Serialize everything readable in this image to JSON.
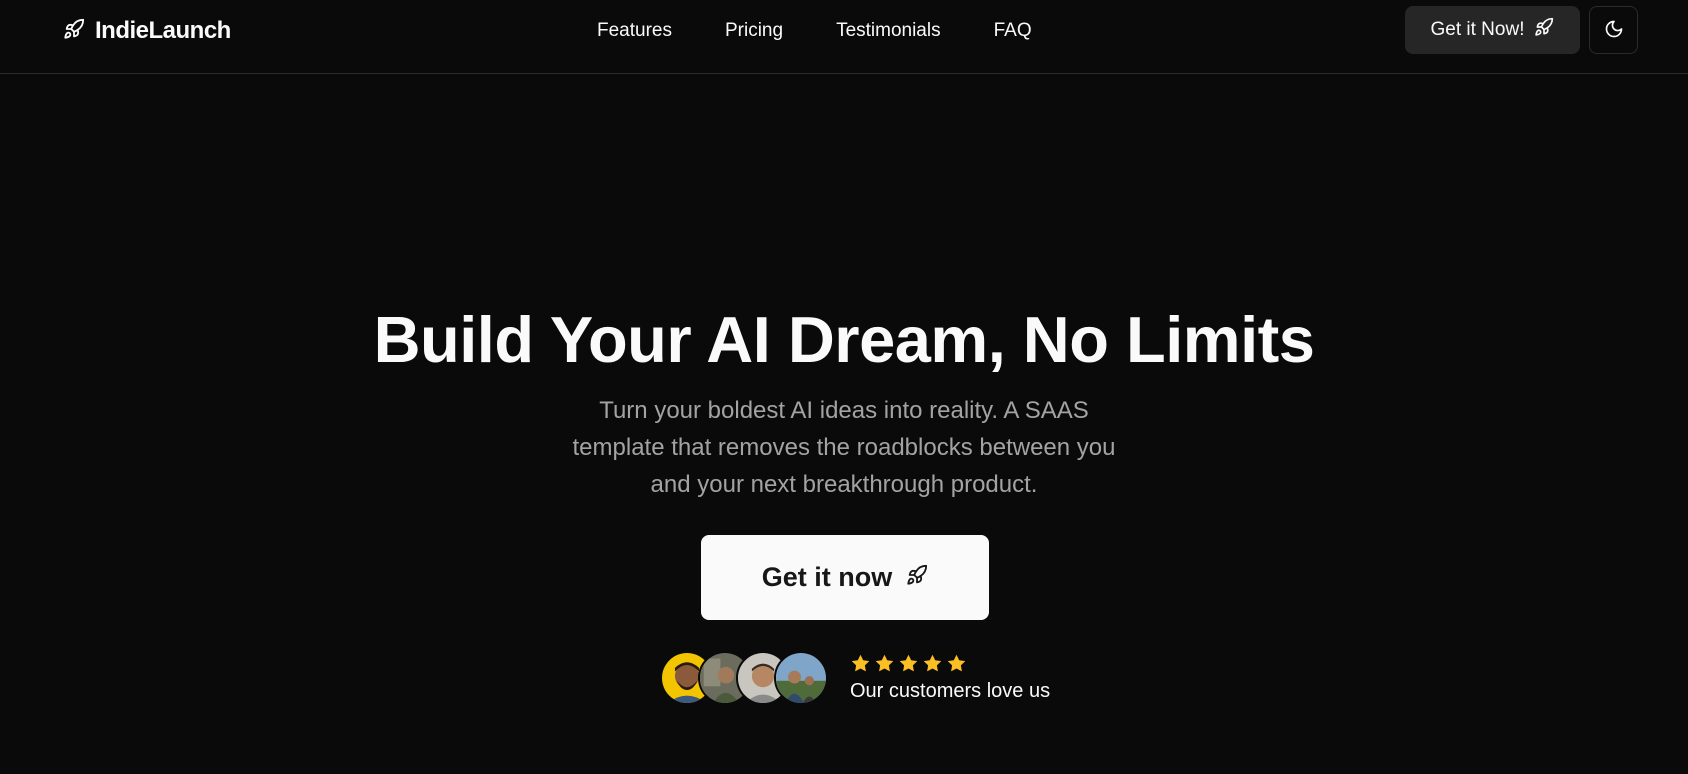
{
  "header": {
    "brand_name": "IndieLaunch",
    "brand_icon": "rocket-icon",
    "nav": [
      {
        "label": "Features"
      },
      {
        "label": "Pricing"
      },
      {
        "label": "Testimonials"
      },
      {
        "label": "FAQ"
      }
    ],
    "cta_label": "Get it Now!",
    "cta_icon": "rocket-icon",
    "theme_toggle_icon": "moon-icon"
  },
  "hero": {
    "title": "Build Your AI Dream, No Limits",
    "subtitle": "Turn your boldest AI ideas into reality. A SAAS template that removes the roadblocks between you and your next breakthrough product.",
    "cta_label": "Get it now",
    "cta_icon": "rocket-icon"
  },
  "social_proof": {
    "avatar_count": 4,
    "star_count": 5,
    "text": "Our customers love us"
  },
  "colors": {
    "background": "#0a0a0a",
    "foreground": "#fafafa",
    "muted": "#a3a3a3",
    "star": "#fbbf24",
    "secondary_button": "#262626"
  }
}
